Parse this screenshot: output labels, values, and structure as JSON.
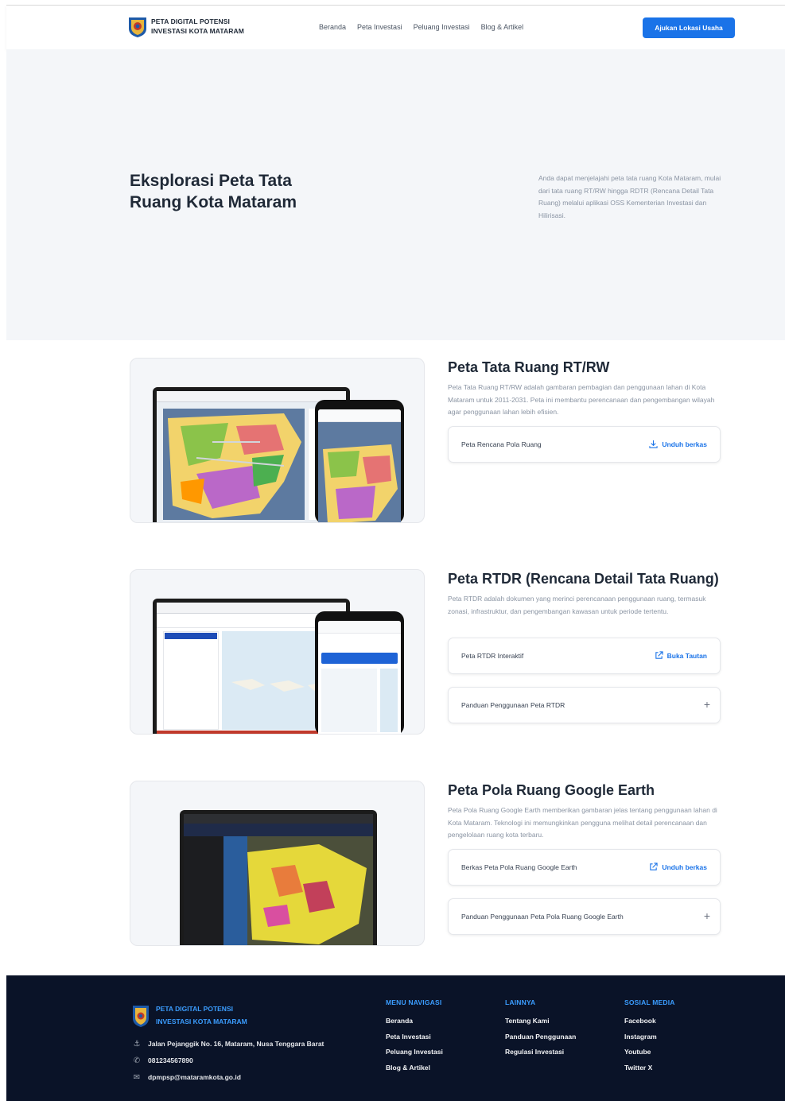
{
  "header": {
    "brand_line1": "PETA DIGITAL POTENSI",
    "brand_line2": "INVESTASI KOTA MATARAM",
    "nav": [
      "Beranda",
      "Peta Investasi",
      "Peluang Investasi",
      "Blog & Artikel"
    ],
    "cta_label": "Ajukan Lokasi Usaha"
  },
  "hero": {
    "title": "Eksplorasi Peta Tata Ruang Kota Mataram",
    "description": "Anda dapat menjelajahi peta tata ruang Kota Mataram, mulai dari tata ruang RT/RW hingga RDTR (Rencana Detail Tata Ruang) melalui aplikasi OSS Kementerian Investasi dan Hilirisasi."
  },
  "sections": [
    {
      "title": "Peta Tata Ruang RT/RW",
      "description": "Peta Tata Ruang RT/RW adalah gambaran pembagian dan penggunaan lahan di Kota Mataram untuk 2011-2031. Peta ini membantu perencanaan dan pengembangan wilayah agar penggunaan lahan lebih efisien.",
      "rows": [
        {
          "label": "Peta Rencana Pola Ruang",
          "action": "Unduh berkas",
          "icon": "download-icon"
        }
      ]
    },
    {
      "title": "Peta RTDR (Rencana Detail Tata Ruang)",
      "description": "Peta RTDR adalah dokumen yang merinci perencanaan penggunaan ruang, termasuk zonasi, infrastruktur, dan pengembangan kawasan untuk periode tertentu.",
      "rows": [
        {
          "label": "Peta RTDR Interaktif",
          "action": "Buka Tautan",
          "icon": "external-link-icon"
        },
        {
          "label": "Panduan Penggunaan Peta RTDR",
          "action": "+",
          "icon": "plus-icon"
        }
      ]
    },
    {
      "title": "Peta Pola Ruang Google Earth",
      "description": "Peta Pola Ruang Google Earth memberikan gambaran jelas tentang penggunaan lahan di Kota Mataram. Teknologi ini memungkinkan pengguna melihat detail perencanaan dan pengelolaan ruang kota terbaru.",
      "rows": [
        {
          "label": "Berkas Peta Pola Ruang Google Earth",
          "action": "Unduh berkas",
          "icon": "external-link-icon"
        },
        {
          "label": "Panduan Penggunaan Peta Pola Ruang Google Earth",
          "action": "+",
          "icon": "plus-icon"
        }
      ]
    }
  ],
  "footer": {
    "brand_line1": "PETA DIGITAL POTENSI",
    "brand_line2": "INVESTASI KOTA MATARAM",
    "address": "Jalan Pejanggik No. 16, Mataram, Nusa Tenggara Barat",
    "phone": "081234567890",
    "email": "dpmpsp@mataramkota.go.id",
    "columns": [
      {
        "title": "MENU NAVIGASI",
        "items": [
          "Beranda",
          "Peta Investasi",
          "Peluang Investasi",
          "Blog & Artikel"
        ]
      },
      {
        "title": "LAINNYA",
        "items": [
          "Tentang Kami",
          "Panduan Penggunaan",
          "Regulasi Investasi"
        ]
      },
      {
        "title": "SOSIAL MEDIA",
        "items": [
          "Facebook",
          "Instagram",
          "Youtube",
          "Twitter X"
        ]
      }
    ]
  },
  "colors": {
    "accent": "#1a73e8",
    "footer_bg": "#0a1328",
    "hero_bg": "#f4f6f9"
  }
}
